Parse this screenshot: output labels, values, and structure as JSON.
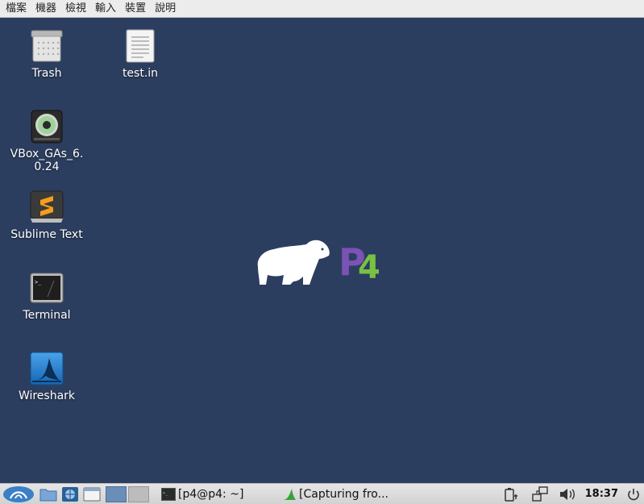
{
  "vbox_menu": [
    "檔案",
    "機器",
    "檢視",
    "輸入",
    "裝置",
    "說明"
  ],
  "desktop_icons": {
    "trash": "Trash",
    "test_in": "test.in",
    "vbox_gas": "VBox_GAs_6.0.24",
    "sublime": "Sublime Text",
    "terminal": "Terminal",
    "wireshark": "Wireshark"
  },
  "logo": {
    "text": "P4",
    "accent_purple": "#7b52b5",
    "accent_green": "#79c043"
  },
  "panel": {
    "tasks": [
      "[p4@p4: ~]",
      "[Capturing fro..."
    ],
    "clock": "18:37"
  },
  "colors": {
    "desktop_bg": "#2c3e5f",
    "panel_bg": "#dcdcdc"
  }
}
